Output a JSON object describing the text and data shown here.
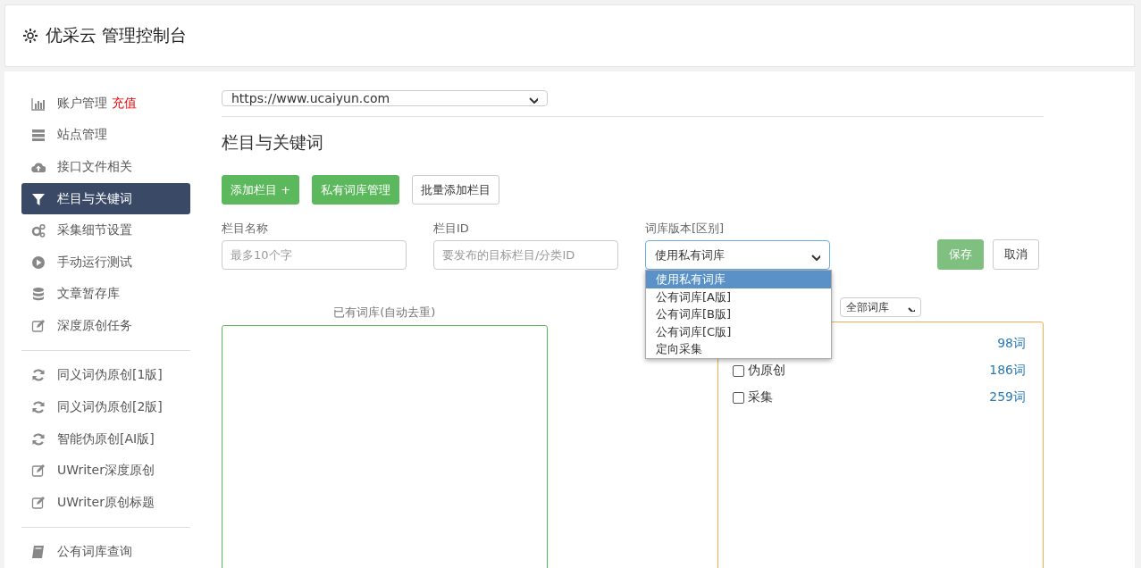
{
  "header": {
    "title": "优采云 管理控制台"
  },
  "sidebar": {
    "groups": [
      [
        {
          "label": "账户管理",
          "badge": "充值",
          "selected": false
        },
        {
          "label": "站点管理",
          "selected": false
        },
        {
          "label": "接口文件相关",
          "selected": false
        },
        {
          "label": "栏目与关键词",
          "selected": true
        },
        {
          "label": "采集细节设置",
          "selected": false
        },
        {
          "label": "手动运行测试",
          "selected": false
        },
        {
          "label": "文章暂存库",
          "selected": false
        },
        {
          "label": "深度原创任务",
          "selected": false
        }
      ],
      [
        {
          "label": "同义词伪原创[1版]",
          "selected": false
        },
        {
          "label": "同义词伪原创[2版]",
          "selected": false
        },
        {
          "label": "智能伪原创[AI版]",
          "selected": false
        },
        {
          "label": "UWriter深度原创",
          "selected": false
        },
        {
          "label": "UWriter原创标题",
          "selected": false
        }
      ],
      [
        {
          "label": "公有词库查询",
          "selected": false
        }
      ]
    ]
  },
  "site_select": {
    "value": "https://www.ucaiyun.com"
  },
  "section_title": "栏目与关键词",
  "buttons": [
    {
      "label": "添加栏目 +",
      "kind": "primary"
    },
    {
      "label": "私有词库管理",
      "kind": "primary"
    },
    {
      "label": "批量添加栏目",
      "kind": "default"
    }
  ],
  "form": {
    "fields": [
      {
        "label": "栏目名称",
        "placeholder": "最多10个字"
      },
      {
        "label": "栏目ID",
        "placeholder": "要发布的目标栏目/分类ID"
      }
    ],
    "library_select": {
      "label": "词库版本[区别]",
      "value": "使用私有词库",
      "expanded": true,
      "options": [
        {
          "label": "使用私有词库",
          "selected": true
        },
        {
          "label": "公有词库[A版]",
          "selected": false
        },
        {
          "label": "公有词库[B版]",
          "selected": false
        },
        {
          "label": "公有词库[C版]",
          "selected": false
        },
        {
          "label": "定向采集",
          "selected": false
        }
      ]
    },
    "save": "保存",
    "cancel": "取消"
  },
  "existing_library": {
    "label": "已有词库(自动去重)"
  },
  "filter_select": {
    "value": "全部词库"
  },
  "word_list": [
    {
      "count": "98词"
    },
    {
      "label": "伪原创",
      "checked": false,
      "count": "186词"
    },
    {
      "label": "采集",
      "checked": false,
      "count": "259词"
    }
  ]
}
